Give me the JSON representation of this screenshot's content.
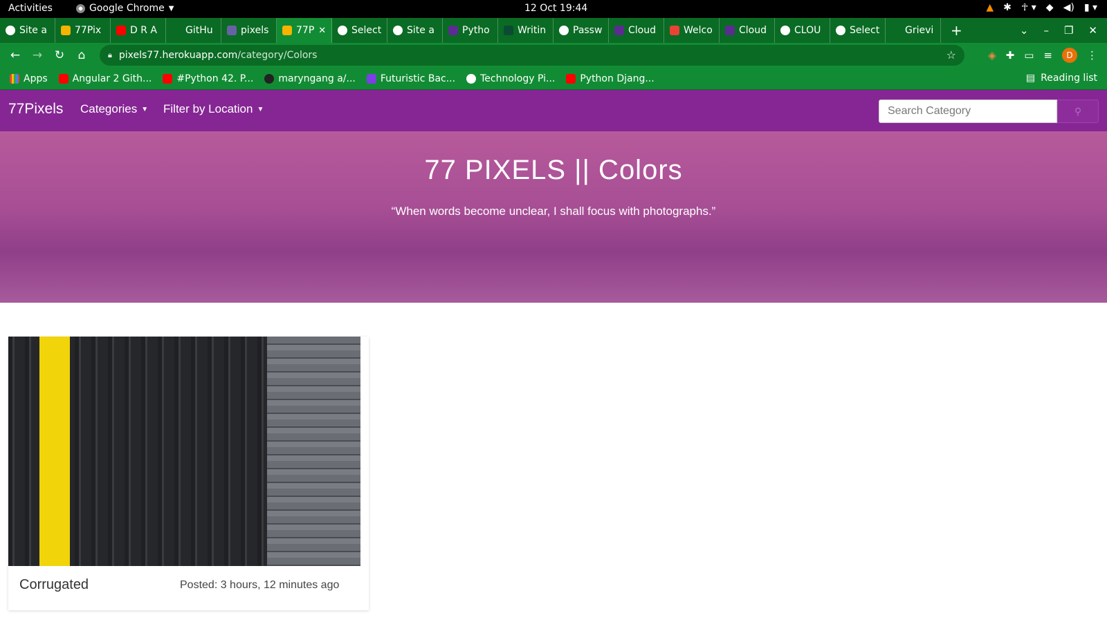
{
  "os": {
    "activities": "Activities",
    "app_name": "Google Chrome",
    "clock": "12 Oct  19:44"
  },
  "browser": {
    "tabs": [
      {
        "label": "Site a",
        "color": "#ffffff"
      },
      {
        "label": "77Pix",
        "color": "#f4b400"
      },
      {
        "label": "D R A",
        "color": "#ff0000"
      },
      {
        "label": "GitHu",
        "color": "#222222"
      },
      {
        "label": "pixels",
        "color": "#6762a6"
      },
      {
        "label": "77P",
        "color": "#f4b400",
        "active": true
      },
      {
        "label": "Select",
        "color": "#ffffff"
      },
      {
        "label": "Site a",
        "color": "#ffffff"
      },
      {
        "label": "Pytho",
        "color": "#5c2d91"
      },
      {
        "label": "Writin",
        "color": "#0c4b33"
      },
      {
        "label": "Passw",
        "color": "#4285f4"
      },
      {
        "label": "Cloud",
        "color": "#5c2d91"
      },
      {
        "label": "Welco",
        "color": "#ea4335"
      },
      {
        "label": "Cloud",
        "color": "#5c2d91"
      },
      {
        "label": "CLOU",
        "color": "#4285f4"
      },
      {
        "label": "Select",
        "color": "#ffffff"
      },
      {
        "label": "Grievi",
        "color": "#222222"
      }
    ],
    "url_host": "pixels77.herokuapp.com",
    "url_path": "/category/Colors",
    "avatar_letter": "D",
    "bookmarks": [
      {
        "label": "Apps",
        "color": "#ea4335"
      },
      {
        "label": "Angular 2 Gith...",
        "color": "#ff0000"
      },
      {
        "label": "#Python 42. P...",
        "color": "#ff0000"
      },
      {
        "label": "maryngang a/...",
        "color": "#222222"
      },
      {
        "label": "Futuristic Bac...",
        "color": "#7b3fe4"
      },
      {
        "label": "Technology Pi...",
        "color": "#ffffff"
      },
      {
        "label": "Python Djang...",
        "color": "#ff0000"
      }
    ],
    "reading_list": "Reading list"
  },
  "site": {
    "brand": "77Pixels",
    "nav": {
      "categories": "Categories",
      "filter_location": "Filter by Location"
    },
    "search_placeholder": "Search Category",
    "hero_title": "77 PIXELS || Colors",
    "hero_quote": "“When words become unclear, I shall focus with photographs.”",
    "colors": {
      "navbar": "#862694",
      "hero": "#a74e95"
    },
    "cards": [
      {
        "title": "Corrugated",
        "posted": "Posted: 3 hours, 12 minutes ago"
      }
    ]
  }
}
